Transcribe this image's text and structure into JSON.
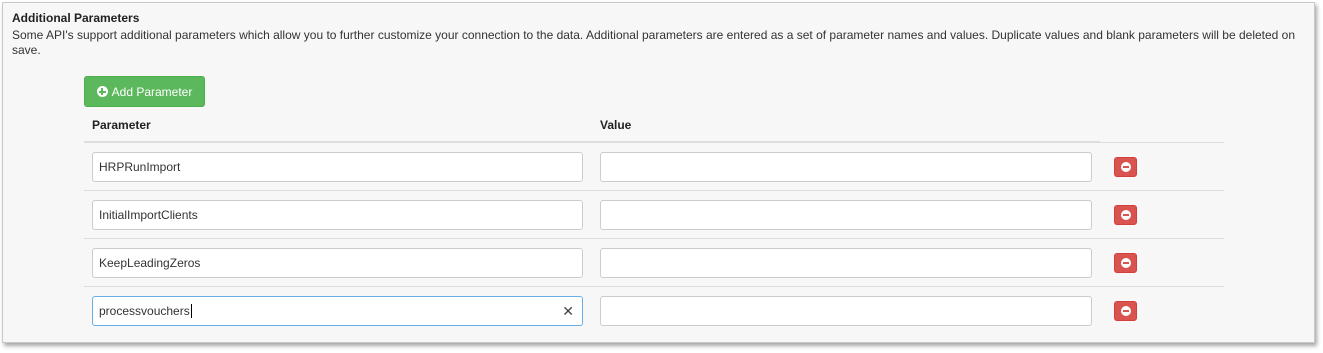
{
  "section": {
    "title": "Additional Parameters",
    "description": "Some API's support additional parameters which allow you to further customize your connection to the data. Additional parameters are entered as a set of parameter names and values. Duplicate values and blank parameters will be deleted on save."
  },
  "add_button": {
    "label": "Add Parameter",
    "color": "#5cb85c",
    "icon": "plus-circle-icon"
  },
  "table": {
    "headers": {
      "parameter": "Parameter",
      "value": "Value"
    },
    "rows": [
      {
        "parameter": "HRPRunImport",
        "value": ""
      },
      {
        "parameter": "InitialImportClients",
        "value": ""
      },
      {
        "parameter": "KeepLeadingZeros",
        "value": ""
      },
      {
        "parameter": "processvouchers",
        "value": "",
        "focused": true
      }
    ],
    "remove_button": {
      "icon": "minus-circle-icon",
      "color": "#d9534f"
    },
    "clear_symbol": "✕"
  }
}
